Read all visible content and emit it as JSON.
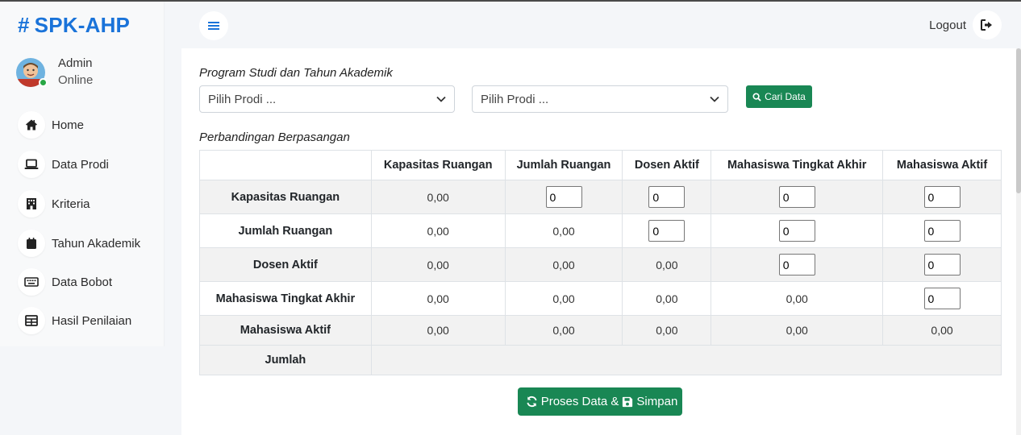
{
  "app": {
    "brand": "SPK-AHP",
    "brand_icon": "hash-icon",
    "brand_color": "#1a73d9"
  },
  "user": {
    "name": "Admin",
    "status": "Online",
    "status_color": "#28a745"
  },
  "sidebar": {
    "items": [
      {
        "label": "Home",
        "icon": "home-icon"
      },
      {
        "label": "Data Prodi",
        "icon": "laptop-icon"
      },
      {
        "label": "Kriteria",
        "icon": "building-icon"
      },
      {
        "label": "Tahun Akademik",
        "icon": "calendar-icon"
      },
      {
        "label": "Data Bobot",
        "icon": "keyboard-icon"
      },
      {
        "label": "Hasil Penilaian",
        "icon": "table-icon"
      }
    ]
  },
  "header": {
    "logout_label": "Logout"
  },
  "filter": {
    "title": "Program Studi dan Tahun Akademik",
    "select_prodi": "Pilih Prodi ...",
    "select_tahun": "Pilih Prodi ...",
    "search_button": "Cari Data"
  },
  "comparison": {
    "title": "Perbandingan Berpasangan",
    "columns": [
      "Kapasitas Ruangan",
      "Jumlah Ruangan",
      "Dosen Aktif",
      "Mahasiswa Tingkat Akhir",
      "Mahasiswa Aktif"
    ],
    "rows": [
      {
        "label": "Kapasitas Ruangan",
        "cells": [
          "0,00",
          "0",
          "0",
          "0",
          "0"
        ]
      },
      {
        "label": "Jumlah Ruangan",
        "cells": [
          "0,00",
          "0,00",
          "0",
          "0",
          "0"
        ]
      },
      {
        "label": "Dosen Aktif",
        "cells": [
          "0,00",
          "0,00",
          "0,00",
          "0",
          "0"
        ]
      },
      {
        "label": "Mahasiswa Tingkat Akhir",
        "cells": [
          "0,00",
          "0,00",
          "0,00",
          "0,00",
          "0"
        ]
      },
      {
        "label": "Mahasiswa Aktif",
        "cells": [
          "0,00",
          "0,00",
          "0,00",
          "0,00",
          "0,00"
        ]
      }
    ],
    "total_label": "Jumlah"
  },
  "actions": {
    "process_part1": "Proses Data &",
    "process_part2": "Simpan",
    "button_color": "#198754"
  }
}
